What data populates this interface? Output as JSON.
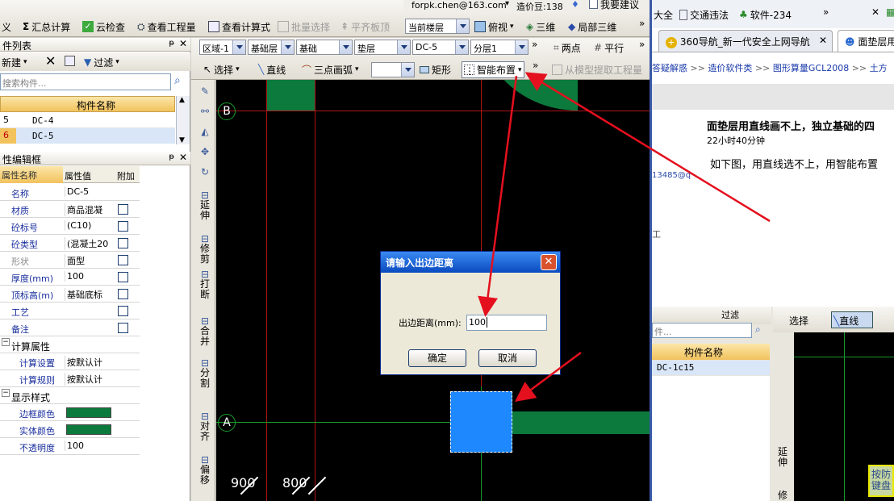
{
  "title_bar": {
    "account": "forpk.chen@163.com",
    "coins": "造价豆:138",
    "suggest": "我要建议"
  },
  "toolbar1": {
    "partial_left": "义",
    "sum_calc": "汇总计算",
    "cloud_check": "云检查",
    "view_quantity": "查看工程量",
    "view_formula": "查看计算式",
    "batch_select": "批量选择",
    "align_slab": "平齐板顶",
    "floor_combo": "当前楼层",
    "top_view": "俯视",
    "three_d": "三维",
    "local_3d": "局部三维"
  },
  "toolbar2": {
    "axis_combo": "区域-1",
    "layer1_combo": "基础层",
    "layer2_combo": "基础",
    "layer3_combo": "垫层",
    "layer4_combo": "DC-5",
    "layer5_combo": "分层1",
    "two_points": "两点",
    "parallel": "平行"
  },
  "toolbar3": {
    "select": "选择",
    "line": "直线",
    "arc": "三点画弧",
    "rect": "矩形",
    "smart_layout": "智能布置",
    "extract": "从模型提取工程量"
  },
  "component_panel": {
    "title": "件列表",
    "new_label": "新建",
    "filter_label": "过滤",
    "search_placeholder": "搜索构件...",
    "header": "构件名称",
    "rows": [
      {
        "idx": "5",
        "name": "DC-4"
      },
      {
        "idx": "6",
        "name": "DC-5"
      }
    ]
  },
  "property_panel": {
    "title": "性编辑框",
    "col_name": "属性名称",
    "col_value": "属性值",
    "col_extra": "附加",
    "rows": [
      {
        "name": "名称",
        "value": "DC-5"
      },
      {
        "name": "材质",
        "value": "商品混凝"
      },
      {
        "name": "砼标号",
        "value": "(C10)"
      },
      {
        "name": "砼类型",
        "value": "(混凝土20"
      },
      {
        "name": "形状",
        "value": "面型"
      },
      {
        "name": "厚度(mm)",
        "value": "100"
      },
      {
        "name": "顶标高(m)",
        "value": "基础底标"
      },
      {
        "name": "工艺",
        "value": ""
      },
      {
        "name": "备注",
        "value": ""
      }
    ],
    "calc_group": "计算属性",
    "calc_rows": [
      {
        "name": "计算设置",
        "value": "按默认计"
      },
      {
        "name": "计算规则",
        "value": "按默认计"
      }
    ],
    "display_group": "显示样式",
    "display_rows": [
      {
        "name": "边框颜色"
      },
      {
        "name": "实体颜色"
      },
      {
        "name": "不透明度",
        "value": "100"
      }
    ]
  },
  "side_tools": [
    "延伸",
    "修剪",
    "打断",
    "合并",
    "分割",
    "对齐",
    "偏移"
  ],
  "canvas": {
    "axis_b": "B",
    "axis_a": "A",
    "dim1": "900",
    "dim2": "800"
  },
  "dialog": {
    "title": "请输入出边距离",
    "label": "出边距离(mm):",
    "value": "100",
    "ok": "确定",
    "cancel": "取消"
  },
  "browser": {
    "top_items": [
      "大全",
      "交通违法",
      "软件-234"
    ],
    "tab1": "360导航_新一代安全上网导航",
    "tab2": "面垫层用",
    "breadcrumb": [
      "答疑解惑",
      "造价软件类",
      "图形算量GCL2008",
      "土方"
    ],
    "article_title": "面垫层用直线画不上，独立基础的四",
    "article_time": "22小时40分钟",
    "article_body": "如下图，用直线选不上，用智能布置",
    "side_id": "13485@q",
    "inner_select": "选择",
    "inner_line": "直线",
    "inner_filter": "过滤",
    "inner_search": "件...",
    "inner_header": "构件名称",
    "inner_row": "DC-1c15",
    "inner_tools": [
      "延伸",
      "修"
    ],
    "badge_line1": "按防",
    "badge_line2": "键盘"
  },
  "colors": {
    "green_fill": "#0c7a3c",
    "blue_fill": "#1e88ff",
    "arrow": "#e4101e",
    "grid_red": "#b01414"
  }
}
